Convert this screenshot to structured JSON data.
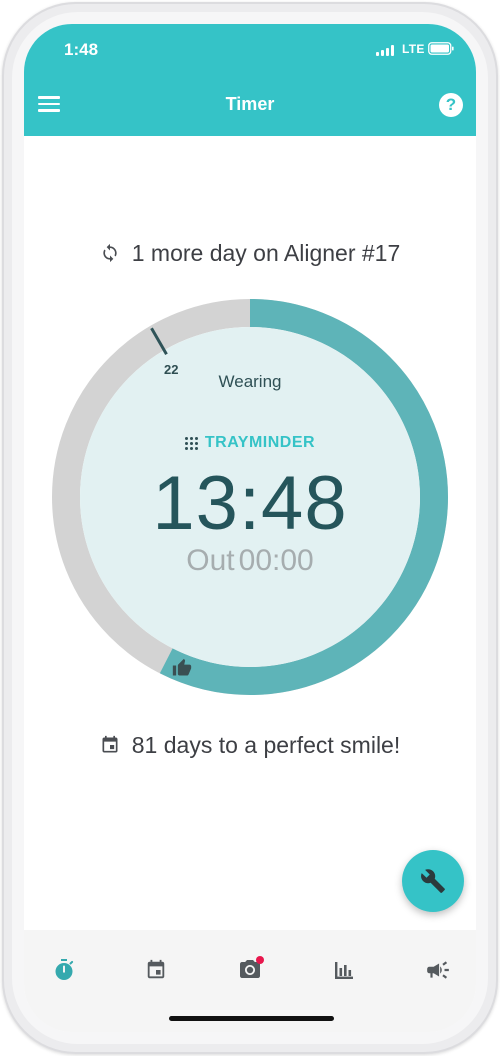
{
  "status_bar": {
    "time": "1:48",
    "network": "LTE"
  },
  "header": {
    "title": "Timer",
    "help_label": "?"
  },
  "aligner": {
    "text": "1 more day on Aligner #17"
  },
  "timer": {
    "ring_label": "Wearing",
    "day_marker": "22",
    "brand": "TRAYMINDER",
    "time": "13:48",
    "out_label": "Out",
    "out_time": "00:00",
    "progress_fraction": 0.575,
    "colors": {
      "progress": "#5eb4b8",
      "track": "#d3d3d3",
      "face": "#e2f1f2",
      "marker": "#2f5358"
    }
  },
  "countdown": {
    "text": "81 days to a perfect smile!"
  },
  "fab": {
    "icon": "wrench-icon"
  },
  "bottom_nav": {
    "items": [
      {
        "icon": "stopwatch-icon",
        "active": true
      },
      {
        "icon": "calendar-icon",
        "active": false
      },
      {
        "icon": "camera-icon",
        "active": false,
        "badge": true
      },
      {
        "icon": "bar-chart-icon",
        "active": false
      },
      {
        "icon": "megaphone-icon",
        "active": false
      }
    ]
  },
  "theme": {
    "accent": "#35c3c7",
    "text_dark": "#3d3f44",
    "badge": "#e8174d"
  }
}
